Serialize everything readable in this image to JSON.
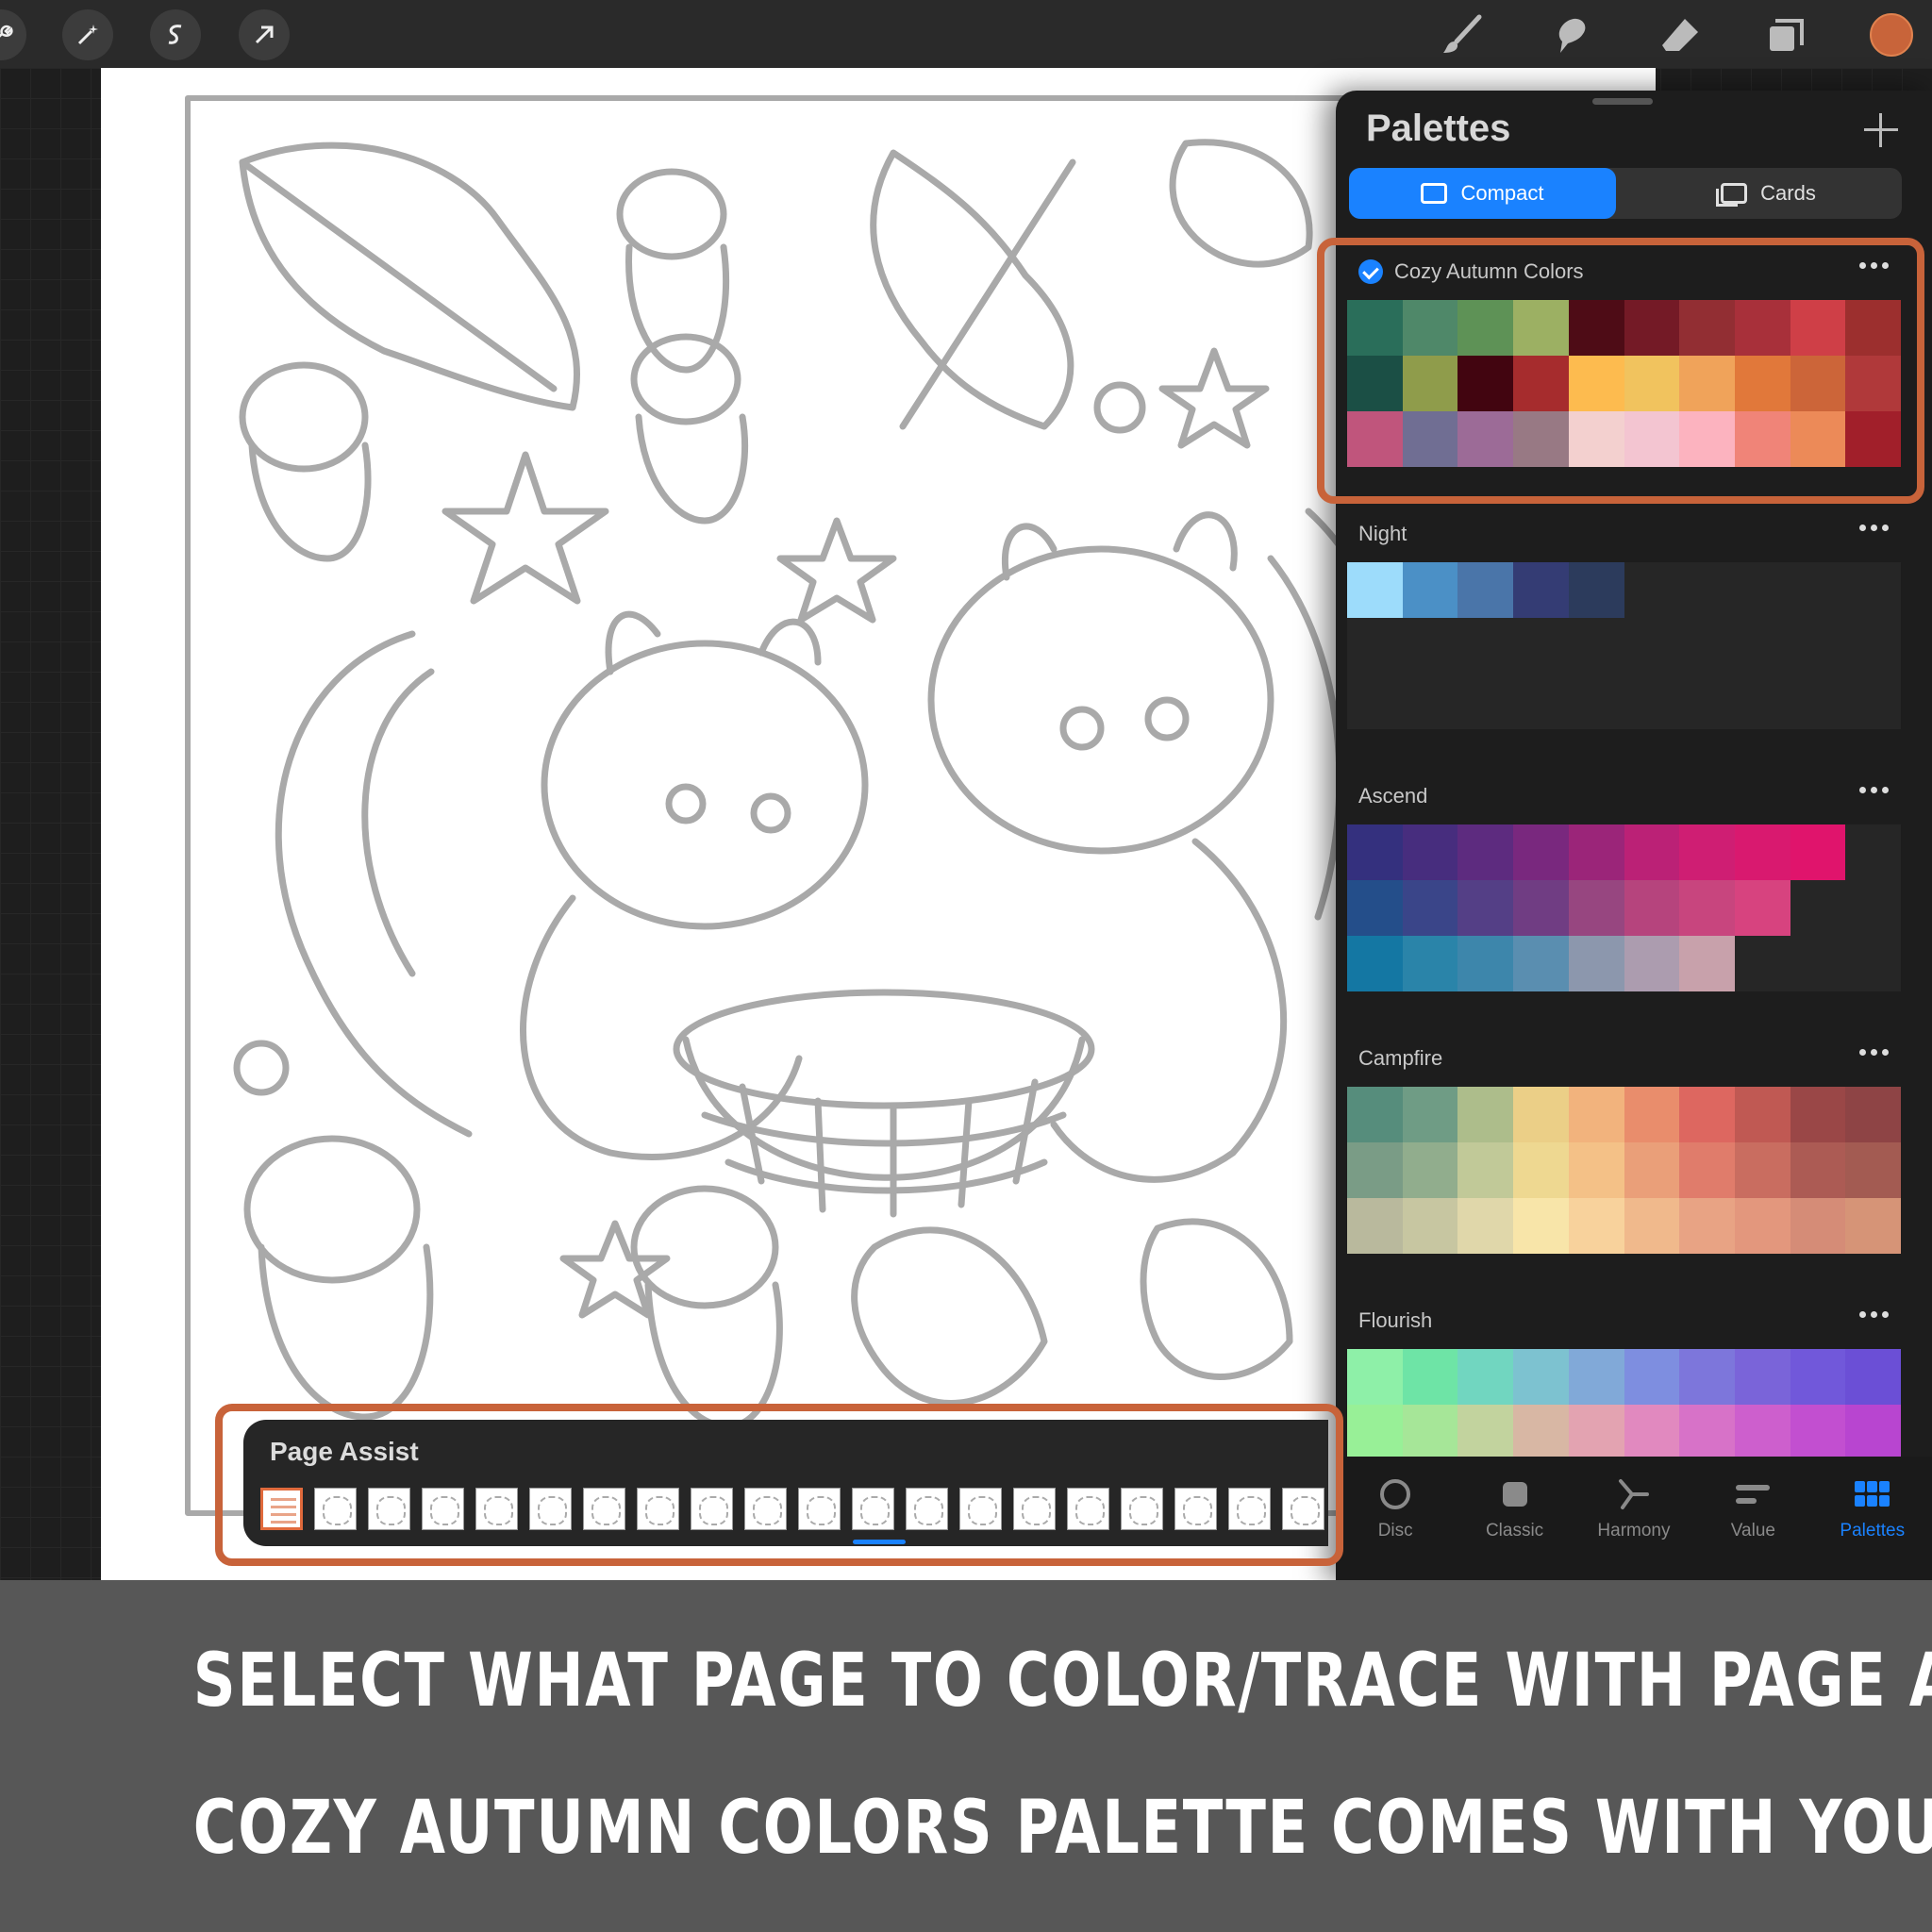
{
  "toolbar": {
    "left_icons": [
      "wrench-icon",
      "magic-wand-icon",
      "selection-icon",
      "transform-arrow-icon"
    ],
    "right_icons": [
      "brush-icon",
      "smudge-icon",
      "eraser-icon",
      "layers-icon"
    ],
    "current_color": "#c8643a"
  },
  "palettes_panel": {
    "title": "Palettes",
    "view_modes": [
      {
        "label": "Compact",
        "active": true
      },
      {
        "label": "Cards",
        "active": false
      }
    ],
    "palettes": [
      {
        "name": "Cozy Autumn Colors",
        "default": true,
        "rows": [
          [
            "#2a6e5a",
            "#4f8869",
            "#5e9256",
            "#9cb063",
            "#4e0c16",
            "#741a26",
            "#922e33",
            "#a8303a",
            "#cf3f47",
            "#9c2f2e"
          ],
          [
            "#1b4f45",
            "#8f9c4b",
            "#420510",
            "#a62c2d",
            "#fdbb4f",
            "#f1c35e",
            "#f0a35a",
            "#e1783a",
            "#cc6539",
            "#b0393a"
          ],
          [
            "#c0557c",
            "#706e93",
            "#9c6b97",
            "#987984",
            "#f3d0cf",
            "#f3c5d1",
            "#fcb3bf",
            "#f08478",
            "#ec8a58",
            "#a11f2a"
          ]
        ]
      },
      {
        "name": "Night",
        "default": false,
        "rows": [
          [
            "#9ddcfb",
            "#4b90c6",
            "#4a75a9",
            "#343c74",
            "#2c3b5c",
            null,
            null,
            null,
            null,
            null
          ]
        ]
      },
      {
        "name": "Ascend",
        "default": false,
        "rows": [
          [
            "#34307e",
            "#472d7e",
            "#5d2b7f",
            "#79287e",
            "#9b2579",
            "#bb2176",
            "#cf1e73",
            "#d9196f",
            "#e0146c",
            null
          ],
          [
            "#244e8a",
            "#3a4589",
            "#543f86",
            "#703d83",
            "#974680",
            "#b6447d",
            "#c8457e",
            "#d7437f",
            null,
            null
          ],
          [
            "#1477a3",
            "#2a84a9",
            "#3d86ab",
            "#5a8eb0",
            "#8c97ad",
            "#ac9caf",
            "#c8a1ab",
            null,
            null,
            null
          ]
        ]
      },
      {
        "name": "Campfire",
        "default": false,
        "rows": [
          [
            "#568d7c",
            "#6f9c85",
            "#adbd8b",
            "#ebcf87",
            "#f2b37d",
            "#e98d6c",
            "#dd6760",
            "#c05953",
            "#9a4747",
            "#8e4445"
          ],
          [
            "#7a9c86",
            "#91ad8d",
            "#c1c998",
            "#eed891",
            "#f4c187",
            "#ea9f79",
            "#e07c6b",
            "#c96d60",
            "#ac5b54",
            "#a35b52"
          ],
          [
            "#b9b99d",
            "#c7c6a1",
            "#e0d7aa",
            "#f8e5a9",
            "#f8d29c",
            "#f0b98c",
            "#e8a384",
            "#e3977d",
            "#d58c77",
            "#d69477"
          ]
        ]
      },
      {
        "name": "Flourish",
        "default": false,
        "rows": [
          [
            "#8ef0a8",
            "#6ee4a6",
            "#71d6c0",
            "#7dc2d0",
            "#81a9d8",
            "#7e8ee0",
            "#7d76db",
            "#7a64d9",
            "#7158da",
            "#6b4fd6"
          ],
          [
            "#98f097",
            "#a6e698",
            "#c2d39e",
            "#d8b7a4",
            "#e3a3b1",
            "#e189bf",
            "#d772c8",
            "#cd5fcd",
            "#c24fd0",
            "#b845d0"
          ]
        ]
      }
    ],
    "tabs": [
      {
        "label": "Disc",
        "icon": "disc-icon",
        "active": false
      },
      {
        "label": "Classic",
        "icon": "classic-square-icon",
        "active": false
      },
      {
        "label": "Harmony",
        "icon": "harmony-icon",
        "active": false
      },
      {
        "label": "Value",
        "icon": "value-sliders-icon",
        "active": false
      },
      {
        "label": "Palettes",
        "icon": "palettes-grid-icon",
        "active": true
      }
    ]
  },
  "page_assist": {
    "title": "Page Assist",
    "selected_page": 1
  },
  "caption": {
    "line1": "Select what page to color/trace with Page Assist.",
    "line2": "Cozy Autumn Colors palette comes with your purchase."
  },
  "colors": {
    "highlight": "#c8633a",
    "accent": "#1a82ff"
  }
}
